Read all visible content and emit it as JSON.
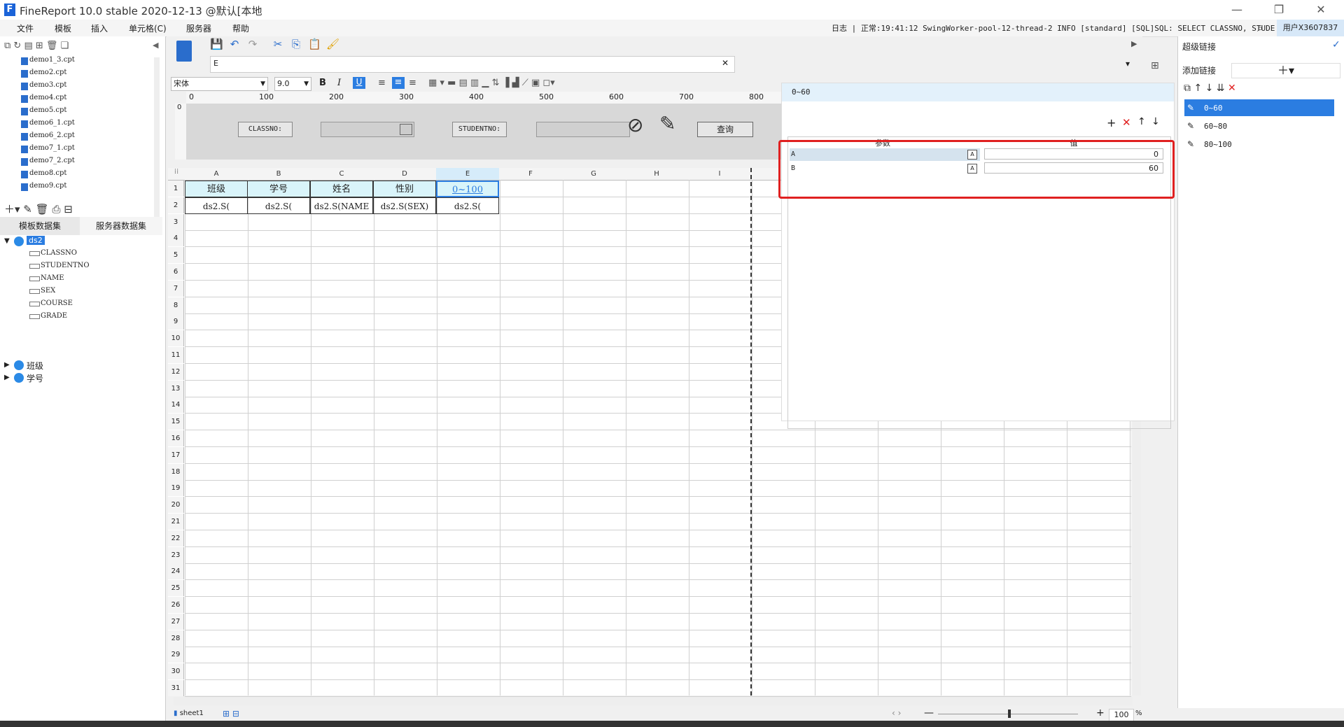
{
  "window": {
    "title": "FineReport 10.0 stable 2020-12-13 @默认[本地"
  },
  "menu": [
    "文件",
    "模板",
    "插入",
    "单元格(C)",
    "服务器",
    "帮助"
  ],
  "log": {
    "label": "日志",
    "text": "正常:19:41:12 SwingWorker-pool-12-thread-2 INFO [standard] [SQL]SQL: SELECT CLASSNO, STUDE..."
  },
  "user": "用户X3607837",
  "templates": [
    "demo1_3.cpt",
    "demo2.cpt",
    "demo3.cpt",
    "demo4.cpt",
    "demo5.cpt",
    "demo6_1.cpt",
    "demo6_2.cpt",
    "demo7_1.cpt",
    "demo7_2.cpt",
    "demo8.cpt",
    "demo9.cpt"
  ],
  "dataset_tabs": [
    "模板数据集",
    "服务器数据集"
  ],
  "datasets": {
    "ds2": {
      "name": "ds2",
      "fields": [
        "CLASSNO",
        "STUDENTNO",
        "NAME",
        "SEX",
        "COURSE",
        "GRADE"
      ]
    },
    "others": [
      "班级",
      "学号"
    ]
  },
  "format": {
    "font": "宋体",
    "size": "9.0"
  },
  "ruler_ticks": [
    "0",
    "100",
    "200",
    "300",
    "400",
    "500",
    "600",
    "700",
    "800"
  ],
  "param_form": {
    "classno_label": "CLASSNO:",
    "studentno_label": "STUDENTNO:",
    "query_button": "查询"
  },
  "columns": [
    "A",
    "B",
    "C",
    "D",
    "E",
    "F",
    "G",
    "H",
    "I"
  ],
  "rows": [
    "1",
    "2",
    "3",
    "4",
    "5",
    "6",
    "7",
    "8",
    "9",
    "10",
    "11",
    "12",
    "13",
    "14",
    "15",
    "16",
    "17",
    "18",
    "19",
    "20",
    "21",
    "22",
    "23",
    "24",
    "25",
    "26",
    "27",
    "28",
    "29",
    "30",
    "31"
  ],
  "cells": {
    "r1": [
      "班级",
      "学号",
      "姓名",
      "性别",
      "0~100"
    ],
    "r2": [
      "ds2.S(",
      "ds2.S(",
      "ds2.S(NAME",
      "ds2.S(SEX)",
      "ds2.S("
    ]
  },
  "sheet": "sheet1",
  "zoom": "100",
  "zoom_unit": "%",
  "hyperlink": {
    "title": "超级链接",
    "add_label": "添加链接",
    "items": [
      "0~60",
      "60~80",
      "80~100"
    ]
  },
  "popup": {
    "title": "0~60",
    "headers": [
      "参数",
      "值"
    ],
    "params": [
      {
        "name": "A",
        "value": "0"
      },
      {
        "name": "B",
        "value": "60"
      }
    ]
  },
  "colors": {
    "accent": "#2a6dcc",
    "selected": "#2b7de1",
    "highlight_box": "#e02020",
    "header_cell": "#d9f4fa"
  }
}
